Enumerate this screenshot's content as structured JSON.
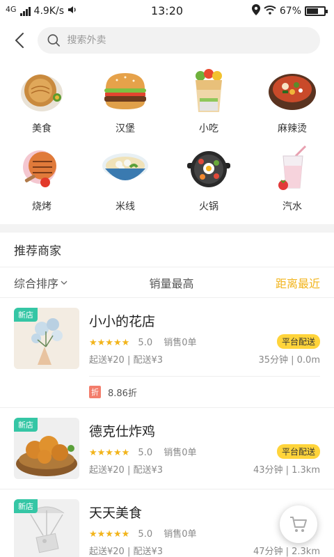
{
  "status_bar": {
    "network": "4G",
    "speed": "4.9K/s",
    "time": "13:20",
    "battery_level": 0.67,
    "battery": "67%"
  },
  "search": {
    "placeholder": "搜索外卖"
  },
  "categories": [
    {
      "label": "美食",
      "icon": "pancake-icon"
    },
    {
      "label": "汉堡",
      "icon": "burger-icon"
    },
    {
      "label": "小吃",
      "icon": "wrap-icon"
    },
    {
      "label": "麻辣烫",
      "icon": "hotpot-bowl-icon"
    },
    {
      "label": "烧烤",
      "icon": "bbq-icon"
    },
    {
      "label": "米线",
      "icon": "noodles-icon"
    },
    {
      "label": "火锅",
      "icon": "hotpot-icon"
    },
    {
      "label": "汽水",
      "icon": "drink-icon"
    }
  ],
  "section_title": "推荐商家",
  "sort": {
    "items": [
      {
        "label": "综合排序",
        "dropdown": true,
        "active": false
      },
      {
        "label": "销量最高",
        "dropdown": false,
        "active": false
      },
      {
        "label": "距离最近",
        "dropdown": false,
        "active": true
      }
    ],
    "active_color": "#f2b41b"
  },
  "stores": [
    {
      "badge": "新店",
      "name": "小小的花店",
      "stars": "★★★★★",
      "rating": "5.0",
      "sales": "销售0单",
      "delivery_tag": "平台配送",
      "fees": "起送¥20 | 配送¥3",
      "time_distance": "35分钟 | 0.0m",
      "promo": {
        "tag": "折",
        "text": "8.86折"
      }
    },
    {
      "badge": "新店",
      "name": "德克仕炸鸡",
      "stars": "★★★★★",
      "rating": "5.0",
      "sales": "销售0单",
      "delivery_tag": "平台配送",
      "fees": "起送¥20 | 配送¥3",
      "time_distance": "43分钟 | 1.3km"
    },
    {
      "badge": "新店",
      "name": "天天美食",
      "stars": "★★★★★",
      "rating": "5.0",
      "sales": "销售0单",
      "fees": "起送¥20 | 配送¥3",
      "time_distance": "47分钟 | 2.3km"
    }
  ],
  "colors": {
    "accent": "#f2b41b",
    "new_badge": "#35c6a5",
    "delivery_tag": "#ffd43b",
    "promo_tag": "#f37d6b"
  }
}
